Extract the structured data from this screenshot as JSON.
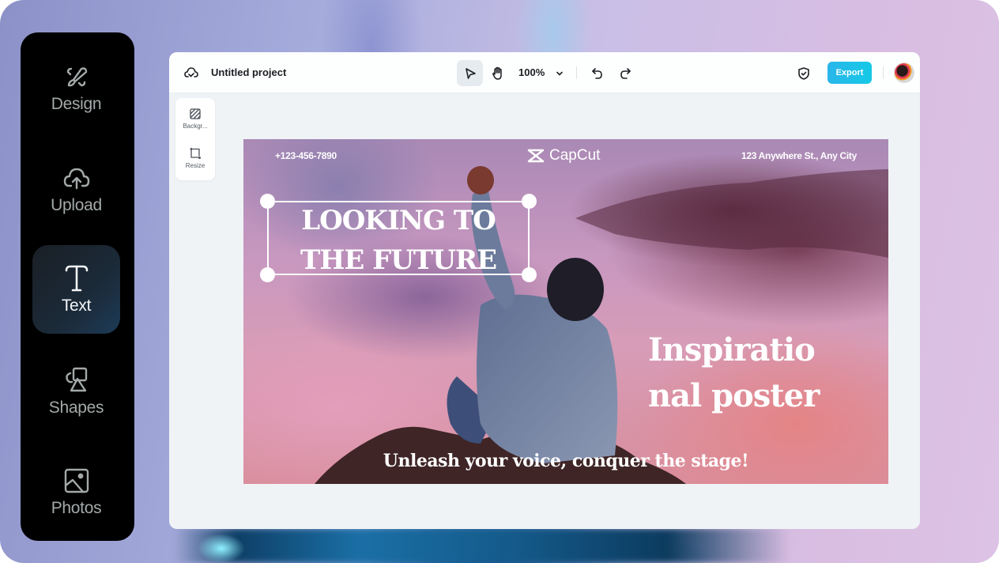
{
  "sidebar": {
    "items": [
      {
        "label": "Design",
        "icon": "rocket-icon",
        "active": false
      },
      {
        "label": "Upload",
        "icon": "cloud-upload-icon",
        "active": false
      },
      {
        "label": "Text",
        "icon": "text-icon",
        "active": true
      },
      {
        "label": "Shapes",
        "icon": "shapes-icon",
        "active": false
      },
      {
        "label": "Photos",
        "icon": "image-icon",
        "active": false
      }
    ]
  },
  "topbar": {
    "project_title": "Untitled project",
    "zoom_level": "100%",
    "export_label": "Export"
  },
  "mini_panel": {
    "items": [
      {
        "label": "Backgr...",
        "icon": "background-icon"
      },
      {
        "label": "Resize",
        "icon": "resize-icon"
      }
    ]
  },
  "poster": {
    "phone": "+123-456-7890",
    "brand": "CapCut",
    "address": "123 Anywhere St., Any City",
    "headline_line1": "LOOKING TO",
    "headline_line2": "THE FUTURE",
    "title_line1": "Inspiratio",
    "title_line2": "nal poster",
    "tagline": "Unleash your voice, conquer the stage!"
  },
  "colors": {
    "export_button": "#15c9e6",
    "sidebar_bg": "#000000",
    "active_item_bg": "#1d3b57"
  }
}
